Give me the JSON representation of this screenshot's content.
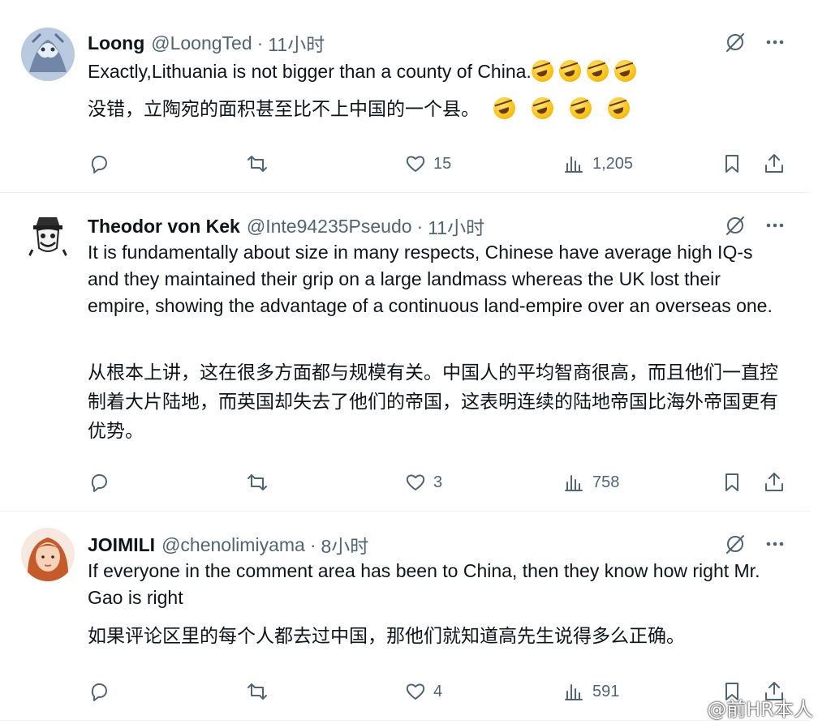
{
  "tweets": [
    {
      "name": "Loong",
      "handle": "@LoongTed",
      "dot": "·",
      "time": "11小时",
      "text": "Exactly,Lithuania is not bigger than a county of China.",
      "translation": "没错，立陶宛的面积甚至比不上中国的一个县。",
      "reply_count": "",
      "retweet_count": "",
      "like_count": "15",
      "view_count": "1,205",
      "avatar_colors": [
        "#c9d6e8",
        "#7e93b8"
      ]
    },
    {
      "name": "Theodor von Kek",
      "handle": "@Inte94235Pseudo",
      "dot": "·",
      "time": "11小时",
      "text": "It is fundamentally about size in many respects, Chinese have average high IQ-s and they maintained their grip on a large landmass whereas the UK lost their empire, showing the advantage of a continuous land-empire over an overseas one.",
      "translation": "从根本上讲，这在很多方面都与规模有关。中国人的平均智商很高，而且他们一直控制着大片陆地，而英国却失去了他们的帝国，这表明连续的陆地帝国比海外帝国更有优势。",
      "reply_count": "",
      "retweet_count": "",
      "like_count": "3",
      "view_count": "758",
      "avatar_colors": [
        "#f4f4f4",
        "#444444"
      ]
    },
    {
      "name": "JOIMILI",
      "handle": "@chenolimiyama",
      "dot": "·",
      "time": "8小时",
      "text": "If everyone in the comment area has been to China, then they know how right Mr. Gao is right",
      "translation": "如果评论区里的每个人都去过中国，那他们就知道高先生说得多么正确。",
      "reply_count": "",
      "retweet_count": "",
      "like_count": "4",
      "view_count": "591",
      "avatar_colors": [
        "#f3c7a8",
        "#c0562e"
      ]
    }
  ],
  "watermark": "@前HR本人"
}
